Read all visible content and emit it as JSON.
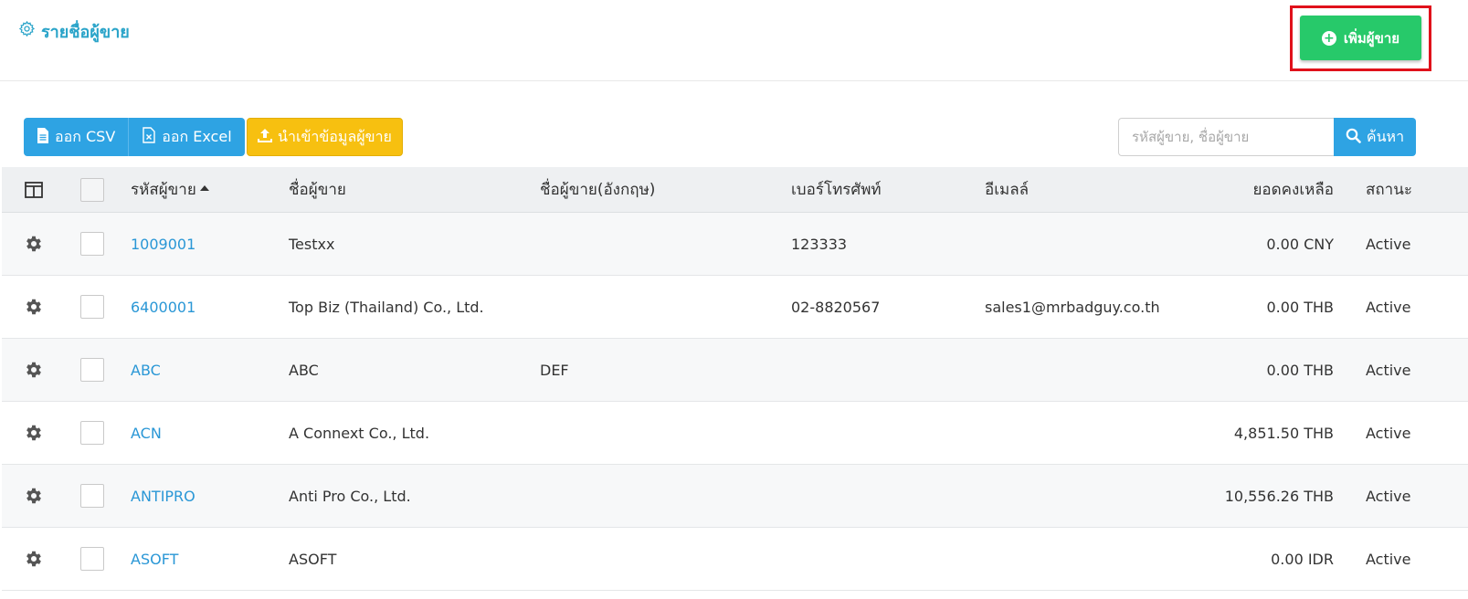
{
  "header": {
    "title": "รายชื่อผู้ขาย",
    "title_icon": "gear-outline-icon",
    "add_button_label": "เพิ่มผู้ขาย",
    "add_button_icon": "plus-circle-icon",
    "accent_color": "#2aa4c9",
    "add_button_color": "#27c96a"
  },
  "toolbar": {
    "export_csv_label": "ออก CSV",
    "export_excel_label": "ออก Excel",
    "import_label": "นำเข้าข้อมูลผู้ขาย",
    "search_placeholder": "รหัสผู้ขาย, ชื่อผู้ขาย",
    "search_button_label": "ค้นหา"
  },
  "table": {
    "columns": {
      "code": "รหัสผู้ขาย",
      "name": "ชื่อผู้ขาย",
      "name_en": "ชื่อผู้ขาย(อังกฤษ)",
      "phone": "เบอร์โทรศัพท์",
      "email": "อีเมลล์",
      "balance": "ยอดคงเหลือ",
      "status": "สถานะ"
    },
    "rows": [
      {
        "code": "1009001",
        "name": "Testxx",
        "name_en": "",
        "phone": "123333",
        "email": "",
        "balance": "0.00 CNY",
        "status": "Active"
      },
      {
        "code": "6400001",
        "name": "Top Biz (Thailand) Co., Ltd.",
        "name_en": "",
        "phone": "02-8820567",
        "email": "sales1@mrbadguy.co.th",
        "balance": "0.00 THB",
        "status": "Active"
      },
      {
        "code": "ABC",
        "name": "ABC",
        "name_en": "DEF",
        "phone": "",
        "email": "",
        "balance": "0.00 THB",
        "status": "Active"
      },
      {
        "code": "ACN",
        "name": "A Connext Co., Ltd.",
        "name_en": "",
        "phone": "",
        "email": "",
        "balance": "4,851.50 THB",
        "status": "Active"
      },
      {
        "code": "ANTIPRO",
        "name": "Anti Pro Co., Ltd.",
        "name_en": "",
        "phone": "",
        "email": "",
        "balance": "10,556.26 THB",
        "status": "Active"
      },
      {
        "code": "ASOFT",
        "name": "ASOFT",
        "name_en": "",
        "phone": "",
        "email": "",
        "balance": "0.00 IDR",
        "status": "Active"
      }
    ]
  }
}
